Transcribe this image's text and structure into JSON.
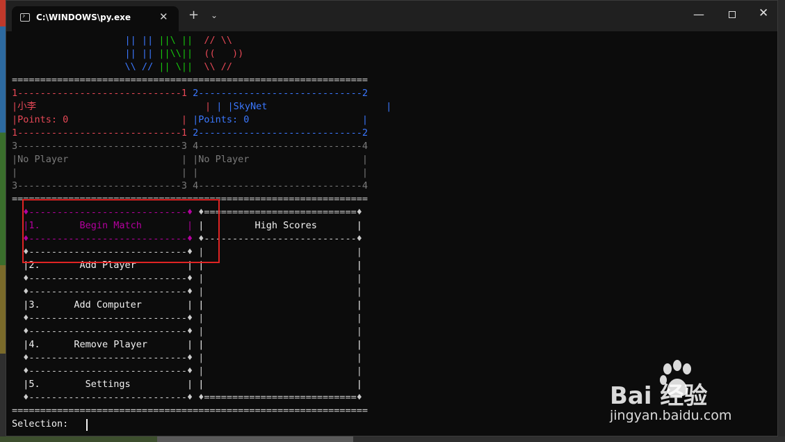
{
  "window": {
    "tab_title": "C:\\WINDOWS\\py.exe",
    "tab_close": "✕",
    "new_tab": "+",
    "dropdown": "⌄",
    "minimize": "—",
    "close": "✕"
  },
  "colors": {
    "terminal_bg": "#0c0c0c",
    "blue": "#3b78ff",
    "green": "#16c60c",
    "red": "#e74856",
    "magenta": "#b4009e",
    "gray": "#7a7a7a",
    "highlight_box": "#e02424"
  },
  "console": {
    "logo": [
      {
        "blue": "                    || || ",
        "green": "||\\ ||  ",
        "red": "// \\\\"
      },
      {
        "blue": "                    || || ",
        "green": "||\\\\||  ",
        "red": "((   ))"
      },
      {
        "blue": "                    \\\\ // ",
        "green": "|| \\||  ",
        "red": "\\\\ //"
      }
    ],
    "separator_top": "===============================================================",
    "player1": {
      "border": "1-----------------------------1",
      "name": "|小李",
      "points": "|Points: 0                    |",
      "border_bottom": "1-----------------------------1"
    },
    "player2": {
      "border": " 2-----------------------------2",
      "name": " | |SkyNet                     |",
      "points": " |Points: 0                    |",
      "border_bottom": " 2-----------------------------2"
    },
    "slot3": {
      "border": "3-----------------------------3",
      "label": "|No Player                    |",
      "empty": "|                             |",
      "border_bottom": "3-----------------------------3"
    },
    "slot4": {
      "border": " 4-----------------------------4",
      "label": " |No Player                    |",
      "empty": " |                             |",
      "border_bottom": " 4-----------------------------4"
    },
    "separator_mid": "===============================================================",
    "menu": {
      "item1_top": "  ♦----------------------------♦",
      "item1": "  |1.       Begin Match        |",
      "item1_bottom": "  ♦----------------------------♦",
      "divider": "  ♦----------------------------♦",
      "item2": "  |2.       Add Player         |",
      "item3": "  |3.      Add Computer        |",
      "item4": "  |4.      Remove Player       |",
      "item5": "  |5.        Settings          |",
      "bottom": "  ♦----------------------------♦"
    },
    "scores": {
      "top": " ♦===========================♦",
      "title": " |         High Scores       |",
      "divider": " ♦---------------------------♦",
      "empty": " |                           |",
      "bottom": " ♦===========================♦"
    },
    "separator_bottom": "===============================================================",
    "prompt": "Selection: "
  },
  "watermark": {
    "brand": "Bai  经验",
    "url": "jingyan.baidu.com"
  }
}
